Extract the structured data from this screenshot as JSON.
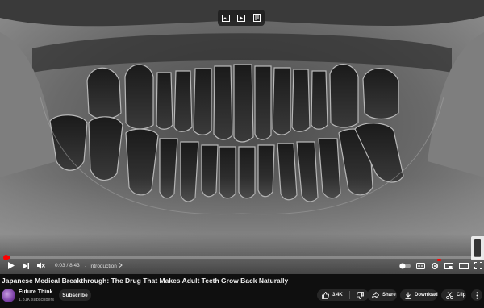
{
  "video": {
    "time_current": "0:03",
    "time_total": "8:43",
    "time_separator": "/",
    "chapter": "Introduction",
    "progress_fraction": 0.006
  },
  "meta": {
    "title": "Japanese Medical Breakthrough: The Drug That Makes Adult Teeth Grow Back Naturally",
    "channel_name": "Future Think",
    "subscribers": "1.31K subscribers",
    "subscribe_label": "Subscribe"
  },
  "actions": {
    "like_count": "3.4K",
    "share_label": "Share",
    "download_label": "Download",
    "clip_label": "Clip"
  },
  "colors": {
    "progress": "#ff0000",
    "background": "#0f0f0f",
    "pill": "#272727"
  },
  "icons": [
    "play-icon",
    "next-icon",
    "mute-icon",
    "chevron-right-icon",
    "subtitles-icon",
    "captions-icon",
    "settings-icon",
    "miniplayer-icon",
    "theater-icon",
    "fullscreen-icon",
    "like-icon",
    "dislike-icon",
    "share-icon",
    "download-icon",
    "clip-icon",
    "more-icon"
  ]
}
